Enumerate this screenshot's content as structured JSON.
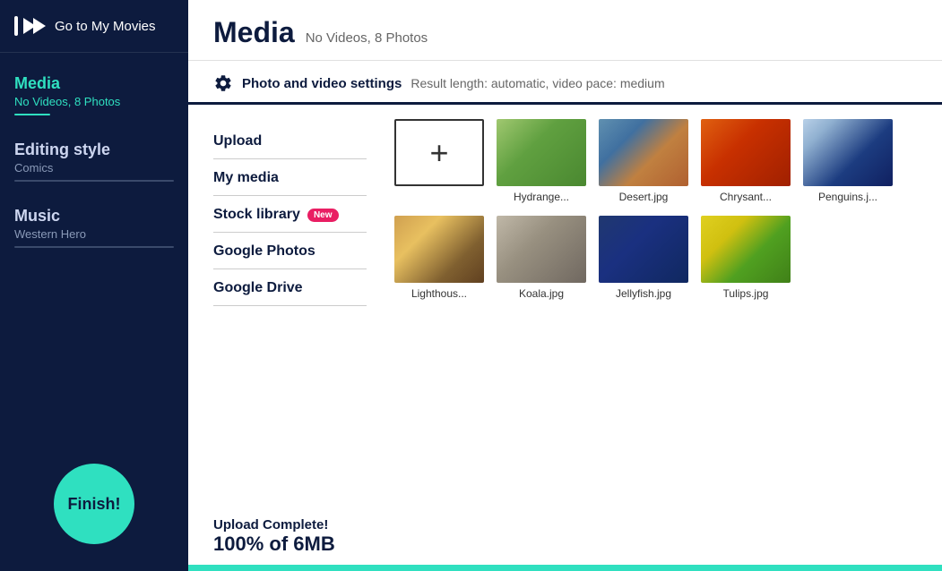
{
  "sidebar": {
    "header_label": "Go to My Movies",
    "sections": [
      {
        "id": "media",
        "title": "Media",
        "subtitle": "No Videos, 8 Photos",
        "active": true
      },
      {
        "id": "editing_style",
        "title": "Editing style",
        "subtitle": "Comics",
        "active": false
      },
      {
        "id": "music",
        "title": "Music",
        "subtitle": "Western Hero",
        "active": false
      }
    ],
    "finish_label": "Finish!"
  },
  "main": {
    "title": "Media",
    "subtitle": "No Videos, 8 Photos",
    "settings": {
      "label": "Photo and video settings",
      "description": "Result length: automatic, video pace: medium"
    },
    "nav_items": [
      {
        "id": "upload",
        "label": "Upload",
        "badge": null
      },
      {
        "id": "my_media",
        "label": "My media",
        "badge": null
      },
      {
        "id": "stock_library",
        "label": "Stock library",
        "badge": "New"
      },
      {
        "id": "google_photos",
        "label": "Google Photos",
        "badge": null
      },
      {
        "id": "google_drive",
        "label": "Google Drive",
        "badge": null
      }
    ],
    "upload_status": {
      "complete_label": "Upload Complete!",
      "percent_label": "100% of 6MB"
    },
    "media_items": [
      {
        "id": "add",
        "type": "add",
        "label": ""
      },
      {
        "id": "hydrangea",
        "type": "image",
        "label": "Hydrange...",
        "color": "#6aaa4a",
        "gradient": "linear-gradient(135deg, #7cc44f 0%, #4a9a2a 50%, #5ab030 100%)"
      },
      {
        "id": "desert",
        "type": "image",
        "label": "Desert.jpg",
        "color": "#b87040",
        "gradient": "linear-gradient(135deg, #c87830 0%, #a05020 50%, #d08040 100%)"
      },
      {
        "id": "chrysant",
        "type": "image",
        "label": "Chrysant...",
        "color": "#e05010",
        "gradient": "linear-gradient(135deg, #e06010 0%, #d04000 50%, #c83000 100%)"
      },
      {
        "id": "penguins",
        "type": "image",
        "label": "Penguins.j...",
        "color": "#506080",
        "gradient": "linear-gradient(135deg, #6070a0 0%, #3050a0 50%, #204080 100%)"
      },
      {
        "id": "lighthouse",
        "type": "image",
        "label": "Lighthous...",
        "color": "#c07830",
        "gradient": "linear-gradient(135deg, #d08840 0%, #e09050 50%, #805020 100%)"
      },
      {
        "id": "koala",
        "type": "image",
        "label": "Koala.jpg",
        "color": "#a0a090",
        "gradient": "linear-gradient(135deg, #b0b0a0 0%, #909080 50%, #808070 100%)"
      },
      {
        "id": "jellyfish",
        "type": "image",
        "label": "Jellyfish.jpg",
        "color": "#3060a0",
        "gradient": "linear-gradient(135deg, #4070c0 0%, #2050a0 50%, #204080 100%)"
      },
      {
        "id": "tulips",
        "type": "image",
        "label": "Tulips.jpg",
        "color": "#d0c020",
        "gradient": "linear-gradient(135deg, #e0d020 0%, #c0b010 50%, #a09000 100%)"
      }
    ]
  },
  "colors": {
    "accent": "#2fe0c0",
    "sidebar_bg": "#0d1b3e",
    "active_text": "#2fe0c0"
  }
}
